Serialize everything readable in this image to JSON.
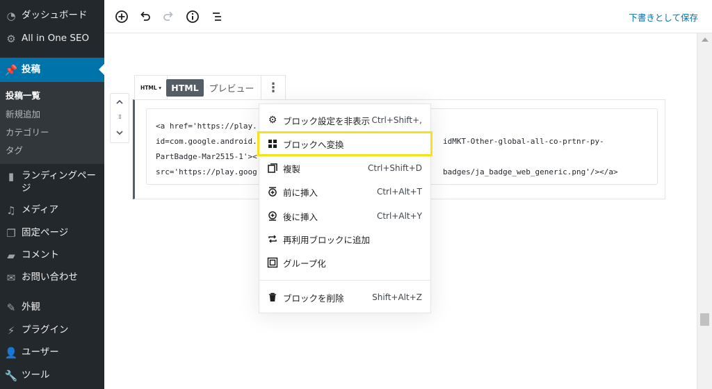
{
  "sidebar": {
    "items": [
      {
        "label": "ダッシュボード",
        "icon": "dashboard-icon"
      },
      {
        "label": "All in One SEO",
        "icon": "gear-icon"
      },
      {
        "label": "投稿",
        "icon": "pin-icon",
        "active": true
      },
      {
        "label": "ランディングページ",
        "icon": "page-icon"
      },
      {
        "label": "メディア",
        "icon": "media-icon"
      },
      {
        "label": "固定ページ",
        "icon": "pages-icon"
      },
      {
        "label": "コメント",
        "icon": "comment-icon"
      },
      {
        "label": "お問い合わせ",
        "icon": "mail-icon"
      },
      {
        "label": "外観",
        "icon": "brush-icon"
      },
      {
        "label": "プラグイン",
        "icon": "plugin-icon"
      },
      {
        "label": "ユーザー",
        "icon": "user-icon"
      },
      {
        "label": "ツール",
        "icon": "wrench-icon"
      }
    ],
    "submenu": [
      {
        "label": "投稿一覧",
        "current": true
      },
      {
        "label": "新規追加"
      },
      {
        "label": "カテゴリー"
      },
      {
        "label": "タグ"
      }
    ]
  },
  "toolbar": {
    "save_draft": "下書きとして保存"
  },
  "block_toolbar": {
    "type_label": "HTML ▾",
    "html_tab": "HTML",
    "preview_tab": "プレビュー"
  },
  "code": {
    "lines": [
      "<a href='https://play.",
      "id=com.google.android.",
      "PartBadge-Mar2515-1'><",
      "src='https://play.goog"
    ],
    "lines_right": [
      "",
      "idMKT-Other-global-all-co-prtnr-py-",
      "",
      "badges/ja_badge_web_generic.png'/></a>"
    ]
  },
  "menu": {
    "items": [
      {
        "label": "ブロック設定を非表示",
        "shortcut": "Ctrl+Shift+,",
        "icon": "gear-icon"
      },
      {
        "label": "ブロックへ変換",
        "shortcut": "",
        "icon": "blocks-icon"
      },
      {
        "label": "複製",
        "shortcut": "Ctrl+Shift+D",
        "icon": "duplicate-icon"
      },
      {
        "label": "前に挿入",
        "shortcut": "Ctrl+Alt+T",
        "icon": "insert-before-icon"
      },
      {
        "label": "後に挿入",
        "shortcut": "Ctrl+Alt+Y",
        "icon": "insert-after-icon"
      },
      {
        "label": "再利用ブロックに追加",
        "shortcut": "",
        "icon": "reusable-icon"
      },
      {
        "label": "グループ化",
        "shortcut": "",
        "icon": "group-icon"
      },
      {
        "label": "ブロックを削除",
        "shortcut": "Shift+Alt+Z",
        "icon": "trash-icon"
      }
    ]
  },
  "colors": {
    "sidebar_bg": "#23282d",
    "active": "#0073aa",
    "highlight": "#f4e31a"
  }
}
